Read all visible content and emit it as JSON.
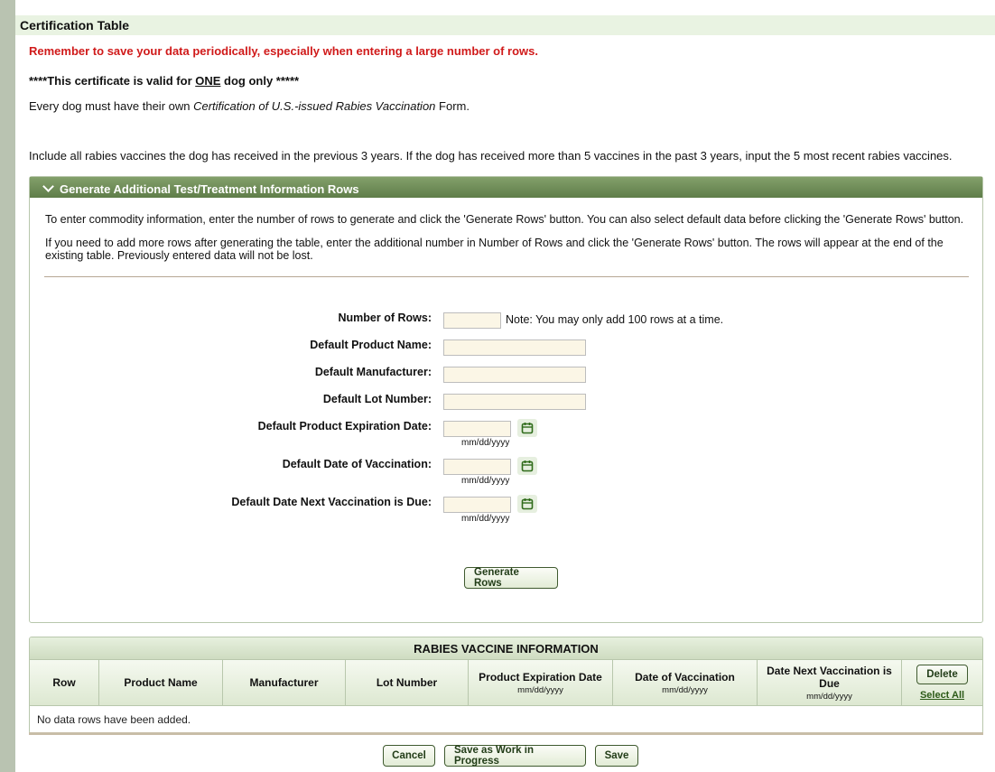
{
  "section": {
    "title": "Certification Table"
  },
  "messages": {
    "warning": "Remember to save your data periodically, especially when entering a large number of rows.",
    "valid_prefix": "****This certificate is valid for ",
    "valid_emph": "ONE",
    "valid_suffix": " dog only *****",
    "every_prefix": "Every dog must have their own ",
    "every_emph": "Certification of U.S.-issued Rabies Vaccination",
    "every_suffix": " Form.",
    "include": "Include all rabies vaccines the dog has received in the previous 3 years. If the dog has received more than 5 vaccines in the past 3 years, input the 5 most recent rabies vaccines."
  },
  "panel": {
    "title": "Generate Additional Test/Treatment Information Rows",
    "p1": "To enter commodity information, enter the number of rows to generate and click the 'Generate Rows' button. You can also select default data before clicking the 'Generate Rows' button.",
    "p2": "If you need to add more rows after generating the table, enter the additional number in Number of Rows and click the 'Generate Rows' button. The rows will appear at the end of the existing table. Previously entered data will not be lost.",
    "fields": {
      "num_rows_label": "Number of Rows:",
      "num_rows_value": "",
      "num_rows_note": "Note: You may only add 100 rows at a time.",
      "product_name_label": "Default Product Name:",
      "product_name_value": "",
      "manufacturer_label": "Default Manufacturer:",
      "manufacturer_value": "",
      "lot_number_label": "Default Lot Number:",
      "lot_number_value": "",
      "expiration_label": "Default Product Expiration Date:",
      "expiration_value": "",
      "vaccination_label": "Default Date of Vaccination:",
      "vaccination_value": "",
      "next_due_label": "Default Date Next Vaccination is Due:",
      "next_due_value": "",
      "date_format": "mm/dd/yyyy"
    },
    "generate_label": "Generate Rows"
  },
  "rabies": {
    "title": "RABIES VACCINE INFORMATION",
    "columns": {
      "row": "Row",
      "product": "Product Name",
      "manufacturer": "Manufacturer",
      "lot": "Lot Number",
      "expiration": "Product Expiration Date",
      "vaccination": "Date of Vaccination",
      "next_due": "Date Next Vaccination is Due",
      "date_format": "mm/dd/yyyy"
    },
    "delete_label": "Delete",
    "select_all_label": "Select All",
    "empty_message": "No data rows have been added."
  },
  "actions": {
    "cancel": "Cancel",
    "save_wip": "Save as Work in Progress",
    "save": "Save"
  },
  "icons": {
    "calendar": "calendar-icon",
    "chevron": "chevron-down-icon"
  },
  "colors": {
    "accent": "#5f7d49",
    "warning": "#d01a1a",
    "field_bg": "#fbf6e6"
  }
}
